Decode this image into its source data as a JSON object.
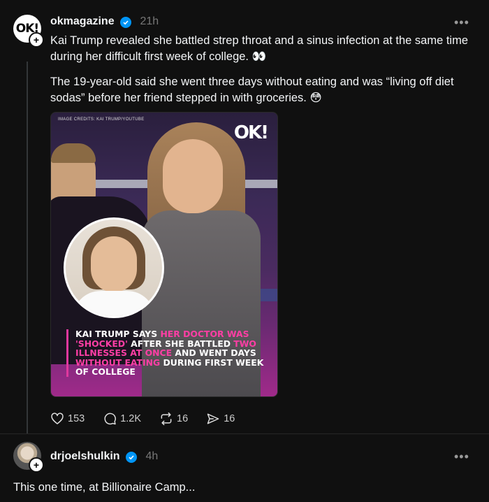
{
  "post1": {
    "avatar_text": "OK!",
    "username": "okmagazine",
    "time": "21h",
    "more": "•••",
    "paragraph1": "Kai Trump revealed she battled strep throat and a sinus infection at the same time during her difficult first week of college. 👀",
    "paragraph2": "The 19-year-old said she went three days without eating and was “living off diet sodas” before her friend stepped in with groceries. 😳",
    "image": {
      "credits": "IMAGE CREDITS: KAI TRUMP/YOUTUBE",
      "logo": "OK!",
      "headline_parts": [
        {
          "text": "KAI TRUMP SAYS ",
          "pink": false
        },
        {
          "text": "HER DOCTOR WAS 'SHOCKED'",
          "pink": true
        },
        {
          "text": " AFTER SHE BATTLED ",
          "pink": false
        },
        {
          "text": "TWO ILLNESSES AT ONCE",
          "pink": true
        },
        {
          "text": " AND WENT DAYS ",
          "pink": false
        },
        {
          "text": "WITHOUT EATING",
          "pink": true
        },
        {
          "text": " DURING FIRST WEEK OF COLLEGE",
          "pink": false
        }
      ]
    },
    "actions": {
      "likes": "153",
      "comments": "1.2K",
      "reposts": "16",
      "shares": "16"
    }
  },
  "post2": {
    "username": "drjoelshulkin",
    "time": "4h",
    "more": "•••",
    "text": "This one time, at Billionaire Camp..."
  },
  "colors": {
    "background": "#101010",
    "verified": "#0095f6",
    "pink_accent": "#ff3ea5"
  }
}
